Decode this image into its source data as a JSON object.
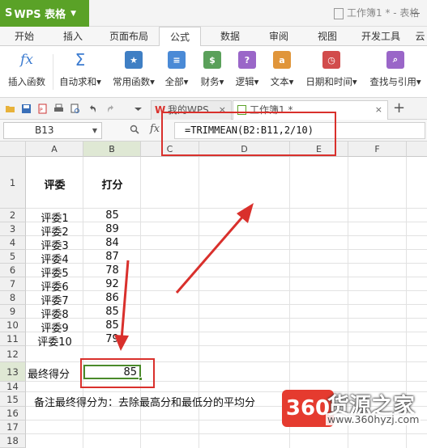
{
  "app": {
    "logo": "S",
    "name": "WPS 表格",
    "doc_title": "工作簿1 * - 表格"
  },
  "ribbon_tabs": [
    "开始",
    "插入",
    "页面布局",
    "公式",
    "数据",
    "审阅",
    "视图",
    "开发工具",
    "云"
  ],
  "active_tab": "公式",
  "ribbon_buttons": [
    {
      "label": "插入函数",
      "icon": "fx",
      "color": "#3b7bd0"
    },
    {
      "label": "自动求和▾",
      "icon": "Σ",
      "color": "#3b7bd0"
    },
    {
      "label": "常用函数▾",
      "icon": "★",
      "color": "#3f7fc4"
    },
    {
      "label": "全部▾",
      "icon": "≡",
      "color": "#4a8ad6"
    },
    {
      "label": "财务▾",
      "icon": "$",
      "color": "#5aa05a"
    },
    {
      "label": "逻辑▾",
      "icon": "?",
      "color": "#9a66c8"
    },
    {
      "label": "文本▾",
      "icon": "a",
      "color": "#e0953a"
    },
    {
      "label": "日期和时间▾",
      "icon": "◷",
      "color": "#d24c4c"
    },
    {
      "label": "查找与引用▾",
      "icon": "⌕",
      "color": "#9a66c8"
    }
  ],
  "doc_tabs": [
    {
      "label": "我的WPS",
      "close": "×"
    },
    {
      "label": "工作簿1 *",
      "close": "×"
    }
  ],
  "new_tab": "+",
  "name_box": "B13",
  "fx_label": "fx",
  "formula": "=TRIMMEAN(B2:B11,2/10)",
  "columns": [
    "A",
    "B",
    "C",
    "D",
    "E",
    "F"
  ],
  "rows": [
    "1",
    "2",
    "3",
    "4",
    "5",
    "6",
    "7",
    "8",
    "9",
    "10",
    "11",
    "12",
    "13",
    "14",
    "15",
    "16",
    "17",
    "18"
  ],
  "header_row": {
    "a": "评委",
    "b": "打分"
  },
  "judges": [
    {
      "name": "评委1",
      "score": "85"
    },
    {
      "name": "评委2",
      "score": "89"
    },
    {
      "name": "评委3",
      "score": "84"
    },
    {
      "name": "评委4",
      "score": "87"
    },
    {
      "name": "评委5",
      "score": "78"
    },
    {
      "name": "评委6",
      "score": "92"
    },
    {
      "name": "评委7",
      "score": "86"
    },
    {
      "name": "评委8",
      "score": "85"
    },
    {
      "name": "评委9",
      "score": "85"
    },
    {
      "name": "评委10",
      "score": "79"
    }
  ],
  "final": {
    "label": "最终得分",
    "value": "85"
  },
  "note": "备注最终得分为：去除最高分和最低分的平均分",
  "watermark": {
    "number": "360",
    "brand": "货源之家",
    "url": "www.360hyzj.com"
  }
}
